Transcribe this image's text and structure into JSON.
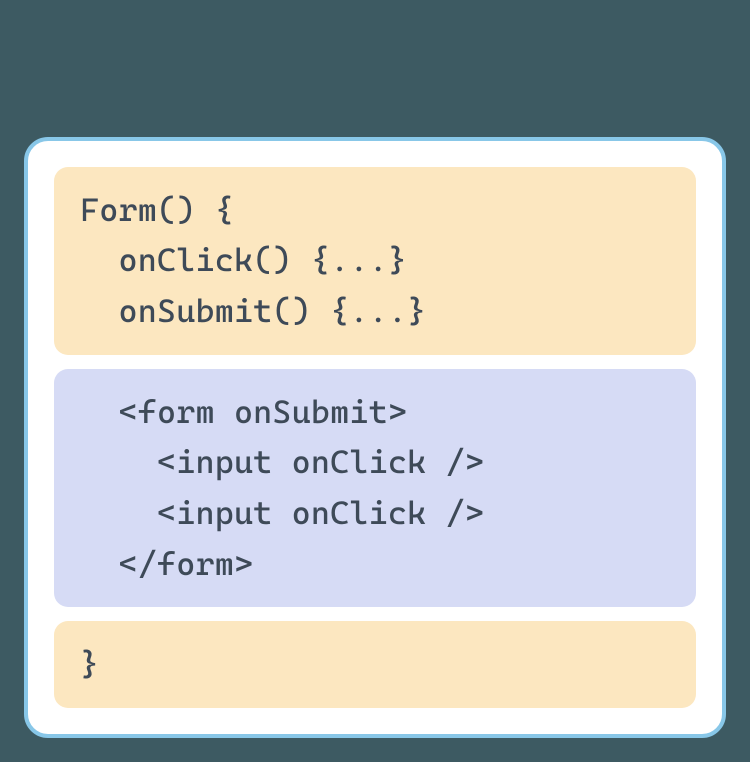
{
  "colors": {
    "orange": "#fce7c0",
    "purple": "#d6dbf5",
    "border": "#88c7e8",
    "bg": "#3d5a62",
    "text": "#3e4a58"
  },
  "blocks": {
    "top": "Form() {\n  onClick() {...}\n  onSubmit() {...}",
    "mid": "  <form onSubmit>\n    <input onClick />\n    <input onClick />\n  </form>",
    "bot": "}"
  }
}
